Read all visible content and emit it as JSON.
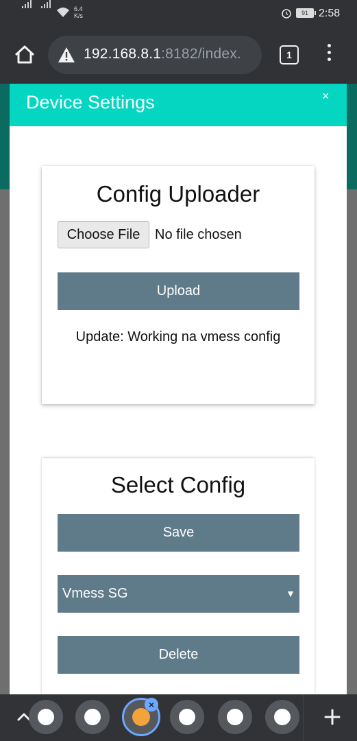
{
  "status_bar": {
    "net_speed_value": "6.4",
    "net_speed_unit": "K/s",
    "battery_level": "91",
    "time": "2:58"
  },
  "browser": {
    "url_host": "192.168.8.1",
    "url_rest": ":8182/index.",
    "tab_count": "1"
  },
  "modal": {
    "title": "Device Settings",
    "close_glyph": "×"
  },
  "config_uploader": {
    "title": "Config Uploader",
    "choose_file_label": "Choose File",
    "file_status": "No file chosen",
    "upload_label": "Upload",
    "update_text": "Update: Working na vmess config"
  },
  "select_config": {
    "title": "Select Config",
    "save_label": "Save",
    "selected_option": "Vmess SG",
    "delete_label": "Delete"
  },
  "tab_strip": {
    "close_badge": "×",
    "icons": [
      "tab-favicon-icon",
      "tab-favicon-icon",
      "refresh-icon",
      "google-icon",
      "tab-favicon-icon",
      "tab-favicon-icon"
    ]
  },
  "colors": {
    "modal_header": "#05d6c2",
    "button": "#5f7b8a",
    "browser_chrome": "#303235",
    "active_tab_ring": "#6ea7ff"
  }
}
